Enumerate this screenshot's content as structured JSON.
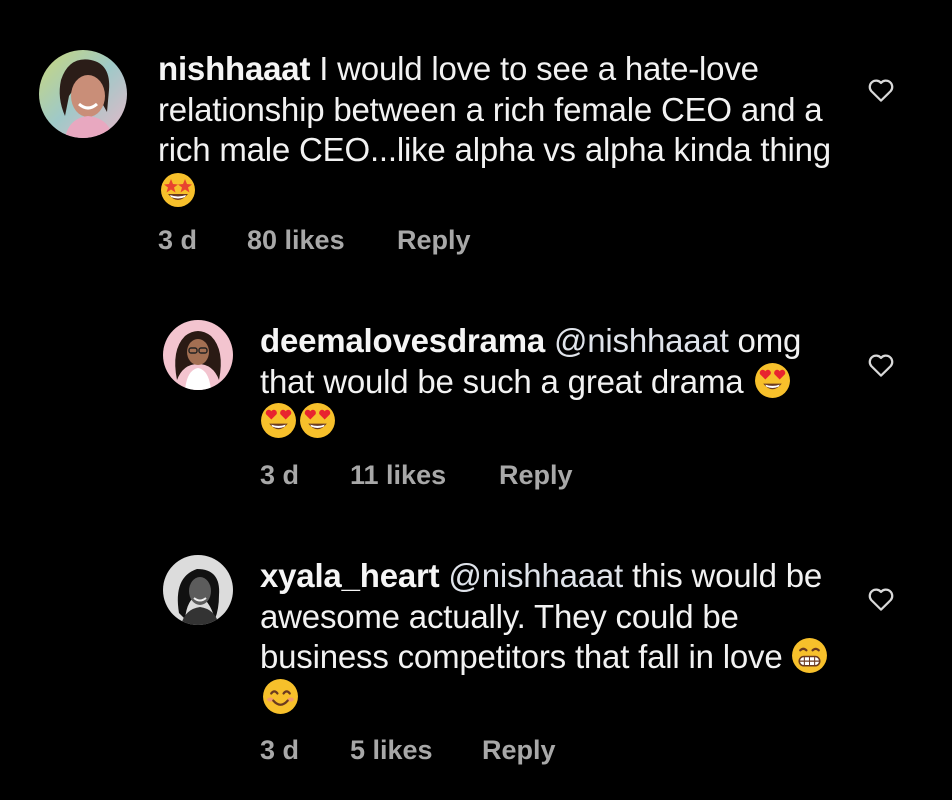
{
  "comments": [
    {
      "username": "nishhaaat",
      "mention": "",
      "text": " I would love to see a hate-love relationship between a rich female CEO and a rich male CEO...like alpha vs alpha kinda thing ",
      "emojis": [
        "star-struck-emoji"
      ],
      "time": "3 d",
      "likes": "80 likes",
      "reply_label": "Reply"
    },
    {
      "username": "deemalovesdrama",
      "mention": "@nishhaaat",
      "text": " omg that would be such a great drama ",
      "emojis": [
        "heart-eyes-emoji",
        "heart-eyes-emoji",
        "heart-eyes-emoji"
      ],
      "time": "3 d",
      "likes": "11 likes",
      "reply_label": "Reply"
    },
    {
      "username": "xyala_heart",
      "mention": "@nishhaaat",
      "text": " this would be awesome actually. They could be business competitors that fall in love ",
      "emojis": [
        "grinning-emoji",
        "smiling-emoji"
      ],
      "time": "3 d",
      "likes": "5 likes",
      "reply_label": "Reply"
    }
  ],
  "icons": {
    "like": "heart-outline-icon"
  },
  "colors": {
    "background": "#000000",
    "text": "#f2f2f2",
    "meta": "#a8a8a8"
  }
}
